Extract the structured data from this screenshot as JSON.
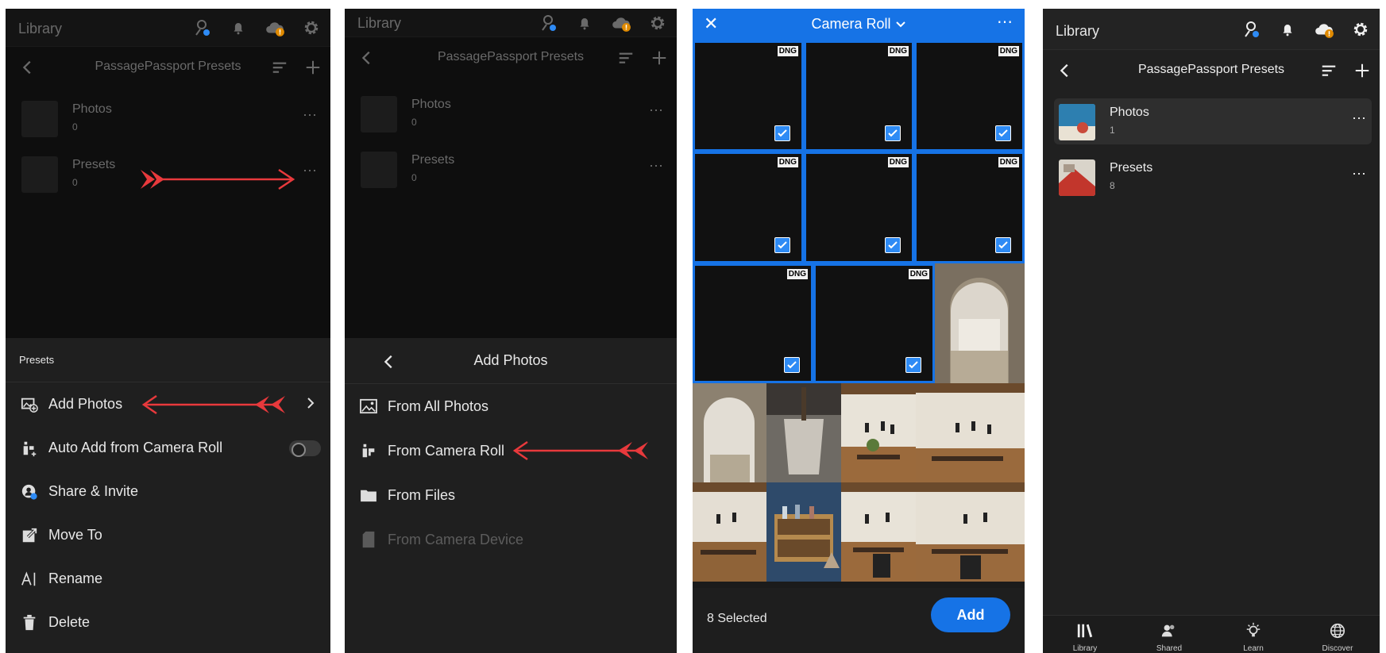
{
  "panels": [
    {
      "header": {
        "title": "Library"
      },
      "subheader": {
        "title": "PassagePassport Presets"
      },
      "albums": [
        {
          "name": "Photos",
          "count": "0"
        },
        {
          "name": "Presets",
          "count": "0"
        }
      ],
      "menu": {
        "title": "Presets",
        "items": [
          {
            "label": "Add Photos",
            "icon": "add-photo-icon"
          },
          {
            "label": "Auto Add from Camera Roll",
            "icon": "auto-add-icon"
          },
          {
            "label": "Share & Invite",
            "icon": "share-invite-icon"
          },
          {
            "label": "Move To",
            "icon": "move-to-icon"
          },
          {
            "label": "Rename",
            "icon": "rename-icon"
          },
          {
            "label": "Delete",
            "icon": "trash-icon"
          }
        ]
      }
    },
    {
      "header": {
        "title": "Library"
      },
      "subheader": {
        "title": "PassagePassport Presets"
      },
      "albums": [
        {
          "name": "Photos",
          "count": "0"
        },
        {
          "name": "Presets",
          "count": "0"
        }
      ],
      "menu": {
        "title": "Add Photos",
        "items": [
          {
            "label": "From All Photos",
            "icon": "image-icon"
          },
          {
            "label": "From Camera Roll",
            "icon": "camera-roll-icon"
          },
          {
            "label": "From Files",
            "icon": "folder-icon"
          },
          {
            "label": "From Camera Device",
            "icon": "sd-card-icon"
          }
        ]
      }
    },
    {
      "header": {
        "title": "Camera Roll"
      },
      "badge": "DNG",
      "footer": {
        "selected": "8 Selected",
        "add_label": "Add"
      }
    },
    {
      "header": {
        "title": "Library"
      },
      "subheader": {
        "title": "PassagePassport Presets"
      },
      "albums": [
        {
          "name": "Photos",
          "count": "1"
        },
        {
          "name": "Presets",
          "count": "8"
        }
      ],
      "tabs": [
        {
          "label": "Library",
          "icon": "library-icon"
        },
        {
          "label": "Shared",
          "icon": "shared-icon"
        },
        {
          "label": "Learn",
          "icon": "lightbulb-icon"
        },
        {
          "label": "Discover",
          "icon": "globe-icon"
        }
      ]
    }
  ],
  "colors": {
    "accent": "#1673e6",
    "arrow": "#e8393c",
    "cloud_badge": "#e08a00",
    "dim_bg": "#0e0e0e"
  }
}
